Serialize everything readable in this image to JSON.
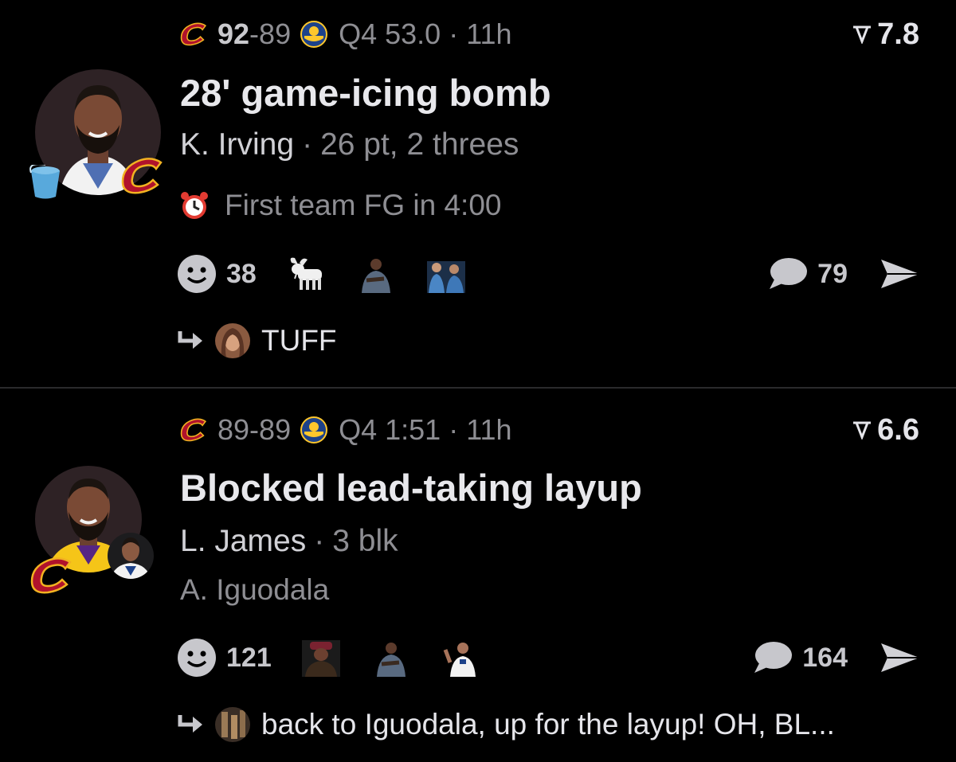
{
  "plays": [
    {
      "away_score": "92",
      "home_score": "89",
      "score_sep": "-",
      "clock": "Q4 53.0",
      "age": "11h",
      "meta_sep": "·",
      "rating": "7.8",
      "title": "28' game-icing bomb",
      "player": "K. Irving",
      "stats": "26 pt, 2 threes",
      "note": "First team FG in 4:00",
      "reaction_count": "38",
      "comment_count": "79",
      "reply_text": "TUFF"
    },
    {
      "away_score": "89",
      "home_score": "89",
      "score_sep": "-",
      "clock": "Q4 1:51",
      "age": "11h",
      "meta_sep": "·",
      "rating": "6.6",
      "title": "Blocked lead-taking layup",
      "player": "L. James",
      "stats": "3 blk",
      "secondary_player": "A. Iguodala",
      "reaction_count": "121",
      "comment_count": "164",
      "reply_text": "back to Iguodala, up for the layup! OH, BL..."
    }
  ],
  "icons": {
    "cavs_logo": "cavaliers-c-icon",
    "warriors_logo": "warriors-icon",
    "rating": "rating-chevron-icon",
    "alarm": "alarm-clock-icon",
    "react": "smiley-icon",
    "comment": "speech-bubble-icon",
    "share": "send-arrow-icon",
    "reply": "reply-arrow-icon"
  },
  "colors": {
    "background": "#000000",
    "cavs_wine": "#b0122c",
    "cavs_gold": "#f2b221",
    "warriors_blue": "#1d428a",
    "warriors_gold": "#ffc72c",
    "muted_text": "#8e8e93",
    "primary_text": "#e8e8ec"
  }
}
